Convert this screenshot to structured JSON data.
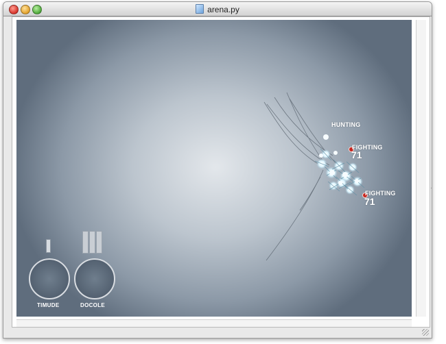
{
  "window": {
    "title": "arena.py"
  },
  "arena": {
    "labels": {
      "hunting": "HUNTING",
      "fighting_1": "FIGHTING",
      "score_1": "71",
      "fighting_2": "FIGHTING",
      "score_2": "71"
    },
    "dials": {
      "left": "TIMUDE",
      "right": "DOCOLE"
    }
  },
  "colors": {
    "arena_center": "#e3e7eb",
    "arena_edge": "#5f6d7d",
    "creature_glow": "#dff6ff",
    "marker": "#c8261f"
  }
}
